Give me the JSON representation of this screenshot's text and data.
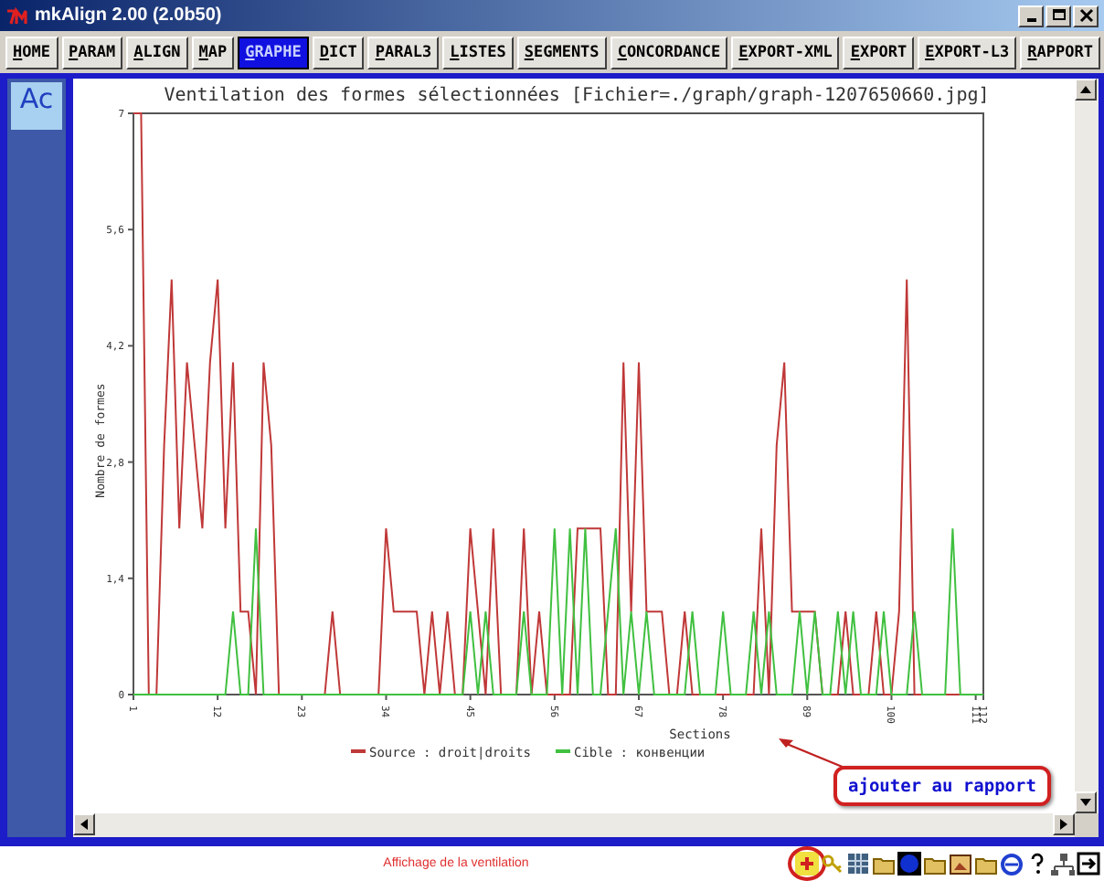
{
  "window": {
    "title": "mkAlign 2.00 (2.0b50)"
  },
  "tabs": [
    {
      "label": "HOME",
      "selected": false
    },
    {
      "label": "PARAM",
      "selected": false
    },
    {
      "label": "ALIGN",
      "selected": false
    },
    {
      "label": "MAP",
      "selected": false
    },
    {
      "label": "GRAPHE",
      "selected": true
    },
    {
      "label": "DICT",
      "selected": false
    },
    {
      "label": "PARAL3",
      "selected": false
    },
    {
      "label": "LISTES",
      "selected": false
    },
    {
      "label": "SEGMENTS",
      "selected": false
    },
    {
      "label": "CONCORDANCE",
      "selected": false
    },
    {
      "label": "EXPORT-XML",
      "selected": false
    },
    {
      "label": "EXPORT",
      "selected": false
    },
    {
      "label": "EXPORT-L3",
      "selected": false
    },
    {
      "label": "RAPPORT",
      "selected": false
    }
  ],
  "sidebar": {
    "logo": "Ac"
  },
  "graph": {
    "chart_data": {
      "type": "line",
      "title": "Ventilation des formes sélectionnées [Fichier=./graph/graph-1207650660.jpg]",
      "xlabel": "Sections",
      "ylabel": "Nombre de formes",
      "x": [
        1,
        2,
        3,
        4,
        5,
        6,
        7,
        8,
        9,
        10,
        11,
        12,
        13,
        14,
        15,
        16,
        17,
        18,
        19,
        20,
        21,
        22,
        23,
        24,
        25,
        26,
        27,
        28,
        29,
        30,
        31,
        32,
        33,
        34,
        35,
        36,
        37,
        38,
        39,
        40,
        41,
        42,
        43,
        44,
        45,
        46,
        47,
        48,
        49,
        50,
        51,
        52,
        53,
        54,
        55,
        56,
        57,
        58,
        59,
        60,
        61,
        62,
        63,
        64,
        65,
        66,
        67,
        68,
        69,
        70,
        71,
        72,
        73,
        74,
        75,
        76,
        77,
        78,
        79,
        80,
        81,
        82,
        83,
        84,
        85,
        86,
        87,
        88,
        89,
        90,
        91,
        92,
        93,
        94,
        95,
        96,
        97,
        98,
        99,
        100,
        101,
        102,
        103,
        104,
        105,
        106,
        107,
        108,
        109,
        110,
        111,
        112
      ],
      "series": [
        {
          "name": "Source : droit|droits",
          "color": "#c03838",
          "values": [
            7,
            7,
            0,
            0,
            3,
            5,
            2,
            4,
            3,
            2,
            4,
            5,
            2,
            4,
            1,
            1,
            0,
            4,
            3,
            0,
            0,
            0,
            0,
            0,
            0,
            0,
            1,
            0,
            0,
            0,
            0,
            0,
            0,
            2,
            1,
            1,
            1,
            1,
            0,
            1,
            0,
            1,
            0,
            0,
            2,
            1,
            0,
            2,
            0,
            0,
            0,
            2,
            0,
            1,
            0,
            0,
            0,
            0,
            2,
            2,
            2,
            2,
            0,
            0,
            4,
            1,
            4,
            1,
            1,
            1,
            0,
            0,
            1,
            0,
            0,
            0,
            0,
            0,
            0,
            0,
            0,
            0,
            2,
            0,
            3,
            4,
            1,
            1,
            1,
            1,
            0,
            0,
            0,
            1,
            0,
            0,
            0,
            1,
            0,
            0,
            1,
            5,
            0,
            0,
            0,
            0,
            0,
            0,
            0,
            0,
            null,
            null
          ]
        },
        {
          "name": "Cible : конвенции",
          "color": "#40c040",
          "values": [
            0,
            0,
            0,
            0,
            0,
            0,
            0,
            0,
            0,
            0,
            0,
            0,
            0,
            1,
            0,
            0,
            2,
            0,
            0,
            0,
            0,
            0,
            0,
            0,
            0,
            0,
            0,
            0,
            0,
            0,
            0,
            0,
            0,
            0,
            0,
            0,
            0,
            0,
            0,
            0,
            0,
            0,
            0,
            0,
            1,
            0,
            1,
            0,
            0,
            0,
            0,
            1,
            0,
            0,
            0,
            2,
            0,
            2,
            0,
            2,
            0,
            0,
            1,
            2,
            0,
            1,
            0,
            1,
            0,
            0,
            0,
            0,
            0,
            1,
            0,
            0,
            0,
            1,
            0,
            0,
            0,
            1,
            0,
            1,
            0,
            0,
            0,
            1,
            0,
            1,
            0,
            0,
            1,
            0,
            1,
            0,
            0,
            0,
            1,
            0,
            0,
            0,
            1,
            0,
            0,
            0,
            0,
            2,
            0,
            0,
            0,
            0
          ]
        }
      ],
      "xlim": [
        1,
        112
      ],
      "ylim": [
        0,
        7
      ],
      "legend": true,
      "xticks": [
        1,
        12,
        23,
        34,
        45,
        56,
        67,
        78,
        89,
        100,
        111,
        112
      ],
      "yticks": [
        0,
        {
          "value": 1.4,
          "label": "1,4"
        },
        {
          "value": 2.8,
          "label": "2,8"
        },
        {
          "value": 4.2,
          "label": "4,2"
        },
        {
          "value": 5.6,
          "label": "5,6"
        },
        7
      ]
    },
    "callout": "ajouter au rapport"
  },
  "status_bar": {
    "message": "Affichage de la ventilation"
  }
}
